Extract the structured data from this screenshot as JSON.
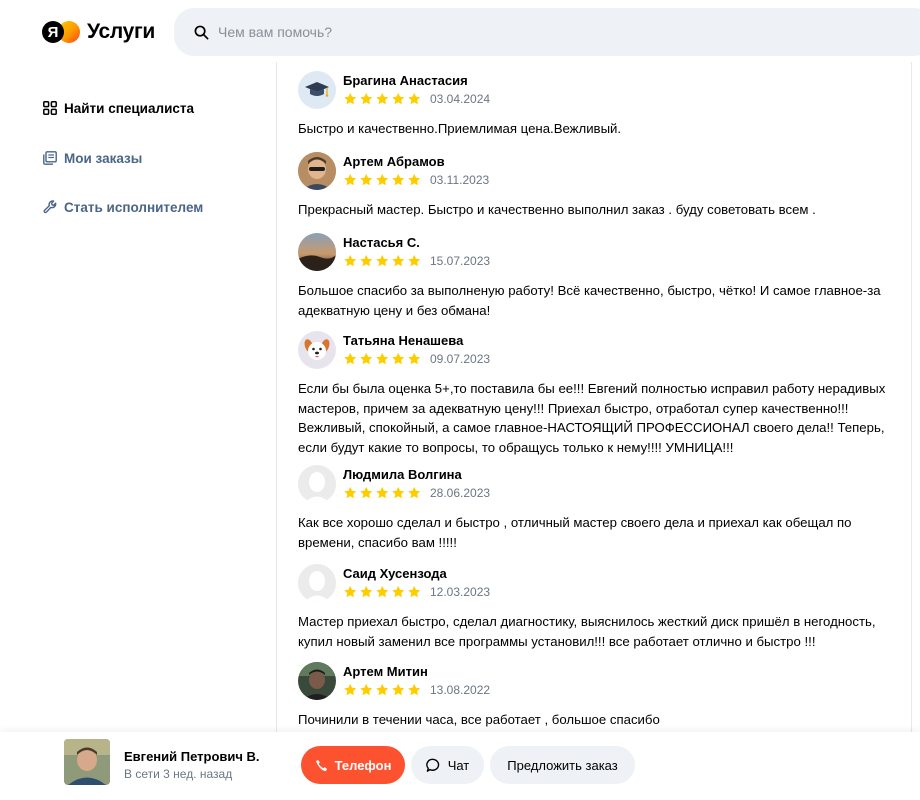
{
  "header": {
    "logo_mark": "Я",
    "logo_text": "Услуги",
    "search_placeholder": "Чем вам помочь?"
  },
  "sidebar": {
    "items": [
      {
        "label": "Найти специалиста",
        "icon": "grid-icon"
      },
      {
        "label": "Мои заказы",
        "icon": "orders-icon"
      },
      {
        "label": "Стать исполнителем",
        "icon": "wrench-icon"
      }
    ]
  },
  "reviews": [
    {
      "name": "Брагина Анастасия",
      "date": "03.04.2024",
      "rating": 5,
      "avatar": "graduation-cap-icon",
      "text": "Быстро и качественно.Приемлимая цена.Вежливый."
    },
    {
      "name": "Артем Абрамов",
      "date": "03.11.2023",
      "rating": 5,
      "avatar": "user-photo",
      "text": "Прекрасный мастер. Быстро и качественно выполнил заказ . буду советовать всем ."
    },
    {
      "name": "Настасья С.",
      "date": "15.07.2023",
      "rating": 5,
      "avatar": "landscape-photo",
      "text": "Большое спасибо за выполненую работу! Всё качественно, быстро, чётко! И самое главное-за адекватную цену и без обмана!"
    },
    {
      "name": "Татьяна Ненашева",
      "date": "09.07.2023",
      "rating": 5,
      "avatar": "dog-icon",
      "text": "Если бы была оценка 5+,то поставила бы ее!!! Евгений полностью исправил работу нерадивых мастеров, причем за адекватную цену!!! Приехал быстро, отработал супер качественно!!! Вежливый, спокойный, а самое главное-НАСТОЯЩИЙ ПРОФЕССИОНАЛ своего дела!! Теперь, если будут какие то вопросы, то обращусь только к нему!!!! УМНИЦА!!!"
    },
    {
      "name": "Людмила Волгина",
      "date": "28.06.2023",
      "rating": 5,
      "avatar": "default-avatar-icon",
      "text": "Как все хорошо сделал и быстро , отличный мастер своего дела и приехал как обещал по времени, спасибо вам !!!!!"
    },
    {
      "name": "Саид Хусензода",
      "date": "12.03.2023",
      "rating": 5,
      "avatar": "default-avatar-icon",
      "text": "Мастер приехал быстро, сделал диагностику, выяснилось жесткий диск пришёл в негодность, купил новый заменил все программы установил!!! все работает отлично и быстро !!!"
    },
    {
      "name": "Артем Митин",
      "date": "13.08.2022",
      "rating": 5,
      "avatar": "user-photo-dark",
      "text": "Починили в течении часа, все работает , большое спасибо"
    }
  ],
  "specialist": {
    "name": "Евгений Петрович В.",
    "status": "В сети 3 нед. назад"
  },
  "actions": {
    "phone": "Телефон",
    "chat": "Чат",
    "offer": "Предложить заказ"
  },
  "colors": {
    "accent": "#fc5230",
    "star": "#ffcc00",
    "nav_muted": "#4a6588",
    "date": "#6b7684"
  }
}
